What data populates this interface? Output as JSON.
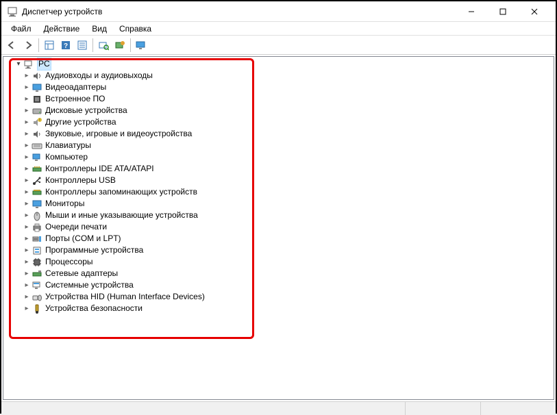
{
  "window": {
    "title": "Диспетчер устройств"
  },
  "menu": {
    "file": "Файл",
    "action": "Действие",
    "view": "Вид",
    "help": "Справка"
  },
  "tree": {
    "root": {
      "label": "PC",
      "icon": "pc"
    },
    "items": [
      {
        "label": "Аудиовходы и аудиовыходы",
        "icon": "audio"
      },
      {
        "label": "Видеоадаптеры",
        "icon": "display"
      },
      {
        "label": "Встроенное ПО",
        "icon": "firmware"
      },
      {
        "label": "Дисковые устройства",
        "icon": "disk"
      },
      {
        "label": "Другие устройства",
        "icon": "other"
      },
      {
        "label": "Звуковые, игровые и видеоустройства",
        "icon": "sound"
      },
      {
        "label": "Клавиатуры",
        "icon": "keyboard"
      },
      {
        "label": "Компьютер",
        "icon": "computer"
      },
      {
        "label": "Контроллеры IDE ATA/ATAPI",
        "icon": "ide"
      },
      {
        "label": "Контроллеры USB",
        "icon": "usb"
      },
      {
        "label": "Контроллеры запоминающих устройств",
        "icon": "storage"
      },
      {
        "label": "Мониторы",
        "icon": "monitor"
      },
      {
        "label": "Мыши и иные указывающие устройства",
        "icon": "mouse"
      },
      {
        "label": "Очереди печати",
        "icon": "printer"
      },
      {
        "label": "Порты (COM и LPT)",
        "icon": "port"
      },
      {
        "label": "Программные устройства",
        "icon": "software"
      },
      {
        "label": "Процессоры",
        "icon": "cpu"
      },
      {
        "label": "Сетевые адаптеры",
        "icon": "network"
      },
      {
        "label": "Системные устройства",
        "icon": "system"
      },
      {
        "label": "Устройства HID (Human Interface Devices)",
        "icon": "hid"
      },
      {
        "label": "Устройства безопасности",
        "icon": "security"
      }
    ]
  }
}
